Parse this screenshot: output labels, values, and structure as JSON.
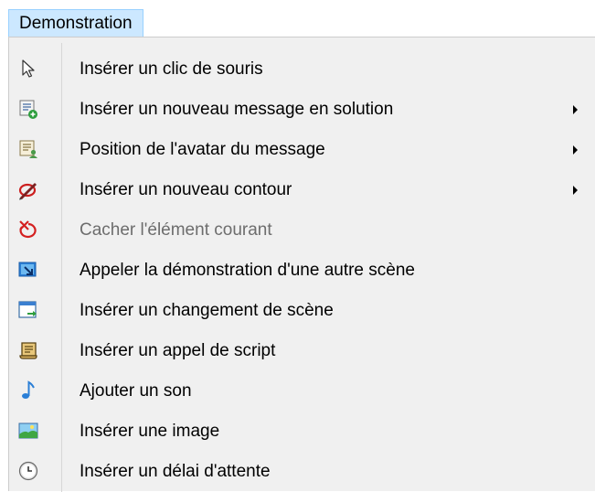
{
  "menu": {
    "title": "Demonstration",
    "items": [
      {
        "label": "Insérer un clic de souris",
        "icon": "mouse-pointer-icon",
        "submenu": false,
        "disabled": false
      },
      {
        "label": "Insérer un nouveau message en solution",
        "icon": "new-message-icon",
        "submenu": true,
        "disabled": false
      },
      {
        "label": "Position de l'avatar du message",
        "icon": "avatar-message-icon",
        "submenu": true,
        "disabled": false
      },
      {
        "label": "Insérer un nouveau contour",
        "icon": "outline-pen-icon",
        "submenu": true,
        "disabled": false
      },
      {
        "label": "Cacher l'élément courant",
        "icon": "hide-element-icon",
        "submenu": false,
        "disabled": true
      },
      {
        "label": "Appeler la démonstration d'une autre scène",
        "icon": "call-scene-icon",
        "submenu": false,
        "disabled": false
      },
      {
        "label": "Insérer un changement de scène",
        "icon": "scene-change-icon",
        "submenu": false,
        "disabled": false
      },
      {
        "label": "Insérer un appel de script",
        "icon": "script-scroll-icon",
        "submenu": false,
        "disabled": false
      },
      {
        "label": "Ajouter un son",
        "icon": "music-note-icon",
        "submenu": false,
        "disabled": false
      },
      {
        "label": "Insérer une image",
        "icon": "image-icon",
        "submenu": false,
        "disabled": false
      },
      {
        "label": "Insérer un délai d'attente",
        "icon": "clock-icon",
        "submenu": false,
        "disabled": false
      }
    ]
  },
  "colors": {
    "menu_title_bg": "#cce8ff",
    "menu_bg": "#f0f0f0",
    "disabled_text": "#6d6d6d"
  }
}
